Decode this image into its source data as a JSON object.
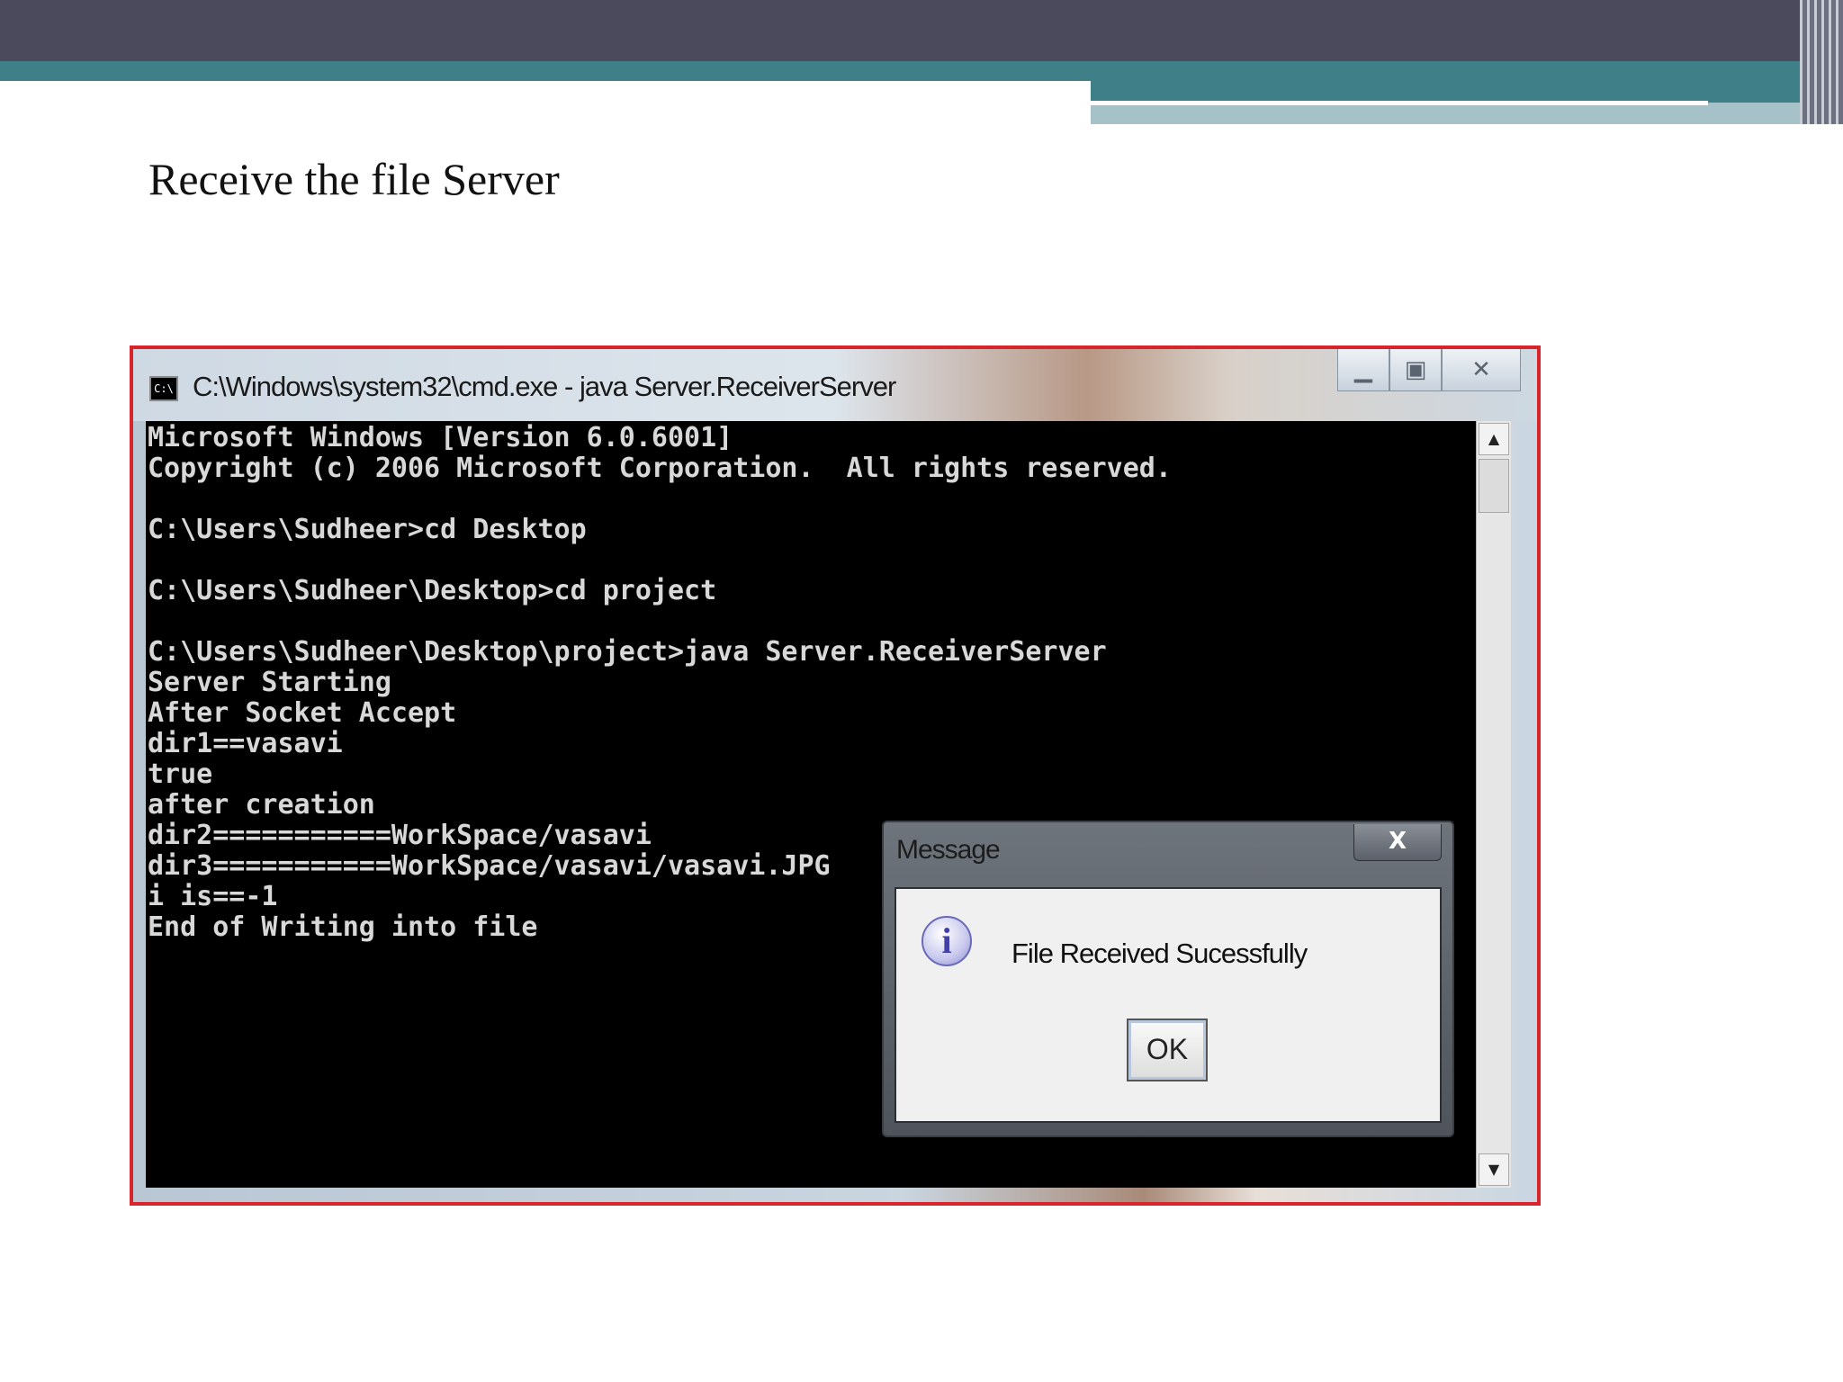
{
  "slide": {
    "title": "Receive the file Server"
  },
  "window": {
    "title": "C:\\Windows\\system32\\cmd.exe - java  Server.ReceiverServer",
    "icon_label": "C:\\",
    "minimize_glyph": "▁",
    "maximize_glyph": "▣",
    "close_glyph": "✕"
  },
  "console": {
    "lines": [
      "Microsoft Windows [Version 6.0.6001]",
      "Copyright (c) 2006 Microsoft Corporation.  All rights reserved.",
      "",
      "C:\\Users\\Sudheer>cd Desktop",
      "",
      "C:\\Users\\Sudheer\\Desktop>cd project",
      "",
      "C:\\Users\\Sudheer\\Desktop\\project>java Server.ReceiverServer",
      "Server Starting",
      "After Socket Accept",
      "dir1==vasavi",
      "true",
      "after creation",
      "dir2===========WorkSpace/vasavi",
      "dir3===========WorkSpace/vasavi/vasavi.JPG",
      "i is==-1",
      "End of Writing into file"
    ]
  },
  "scrollbar": {
    "up_glyph": "▲",
    "down_glyph": "▼"
  },
  "dialog": {
    "title": "Message",
    "close_glyph": "X",
    "icon_glyph": "i",
    "message": "File Received Sucessfully",
    "ok_label": "OK"
  }
}
